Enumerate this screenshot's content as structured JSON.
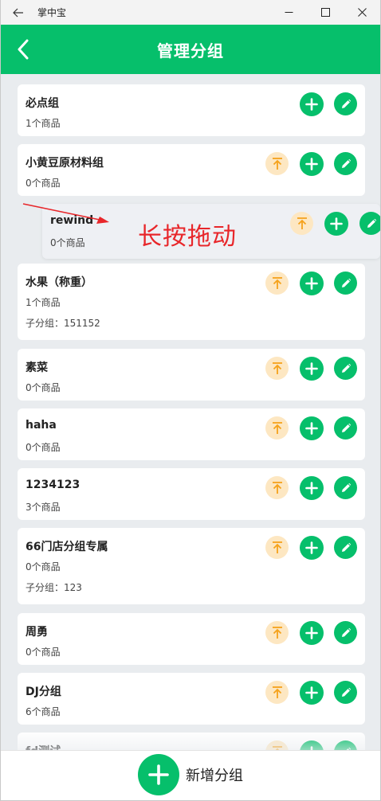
{
  "window": {
    "title": "掌中宝"
  },
  "header": {
    "title": "管理分组"
  },
  "annotation": {
    "text": "长按拖动"
  },
  "groups": [
    {
      "name": "必点组",
      "count": "1个商品",
      "sub": "",
      "pinnable": false
    },
    {
      "name": "小黄豆原材料组",
      "count": "0个商品",
      "sub": "",
      "pinnable": true
    },
    {
      "name": "rewind",
      "count": "0个商品",
      "sub": "",
      "pinnable": true,
      "dragging": true
    },
    {
      "name": "水果（称重）",
      "count": "1个商品",
      "sub": "子分组：151152",
      "pinnable": true
    },
    {
      "name": "素菜",
      "count": "0个商品",
      "sub": "",
      "pinnable": true
    },
    {
      "name": "haha",
      "count": "0个商品",
      "sub": "",
      "pinnable": true
    },
    {
      "name": "1234123",
      "count": "3个商品",
      "sub": "",
      "pinnable": true
    },
    {
      "name": "66门店分组专属",
      "count": "0个商品",
      "sub": "子分组：123",
      "pinnable": true
    },
    {
      "name": "周勇",
      "count": "0个商品",
      "sub": "",
      "pinnable": true
    },
    {
      "name": "DJ分组",
      "count": "6个商品",
      "sub": "",
      "pinnable": true
    },
    {
      "name": "fd测试",
      "count": "",
      "sub": "",
      "pinnable": true
    }
  ],
  "footer": {
    "add_label": "新增分组"
  },
  "icons": {
    "back": "arrow-left-icon",
    "minimize": "minimize-icon",
    "maximize": "maximize-icon",
    "close": "close-icon",
    "pin_top": "pin-top-icon",
    "add": "plus-icon",
    "edit": "pencil-icon"
  },
  "colors": {
    "brand": "#06bf6b",
    "pin_bg": "#fde7c2",
    "pin_fg": "#f5a21b",
    "annotation": "#e8262a"
  }
}
